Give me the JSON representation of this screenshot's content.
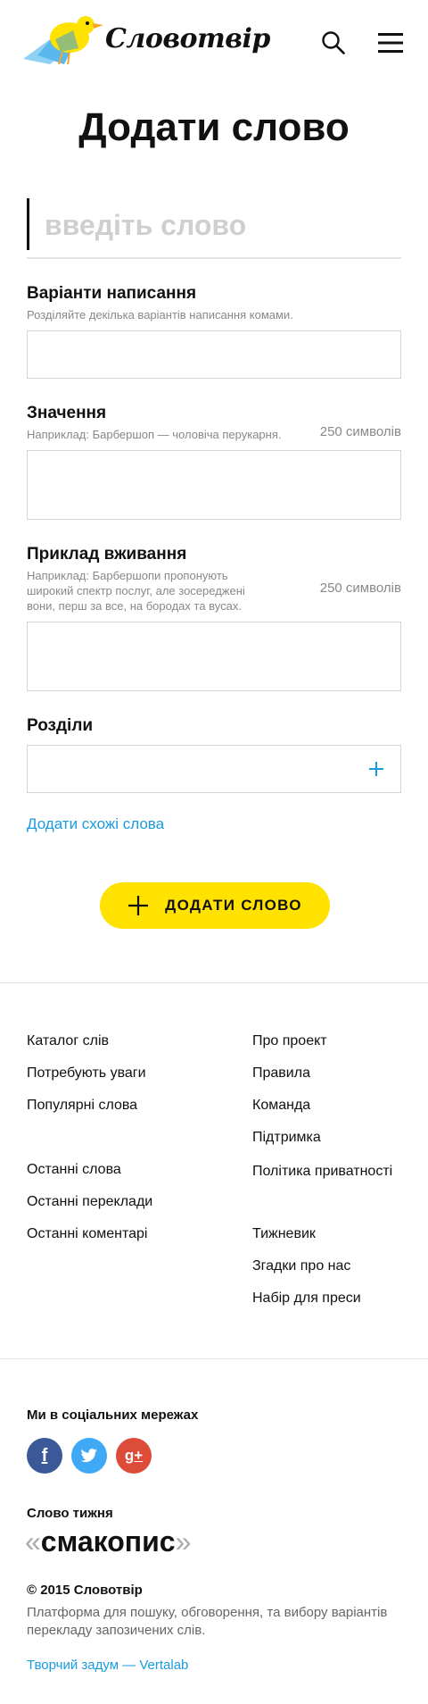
{
  "header": {
    "logo_text": "Словотвір",
    "icons": {
      "search": "search-icon",
      "menu": "menu-icon"
    }
  },
  "page_title": "Додати слово",
  "word_input": {
    "placeholder": "введіть слово",
    "value": ""
  },
  "spelling": {
    "title": "Варіанти написання",
    "hint": "Розділяйте декілька варіантів написання комами.",
    "value": ""
  },
  "meaning": {
    "title": "Значення",
    "hint": "Наприклад: Барбершоп — чоловіча перукарня.",
    "counter": "250 символів",
    "value": ""
  },
  "example": {
    "title": "Приклад вживання",
    "hint": "Наприклад: Барбершопи пропонують широкий спектр послуг, але зосереджені вони, перш за все, на бородах та вусах.",
    "counter": "250 символів",
    "value": ""
  },
  "sections": {
    "title": "Розділи",
    "value": ""
  },
  "similar_link": "Додати схожі слова",
  "add_button": "ДОДАТИ СЛОВО",
  "footer": {
    "left_links": [
      "Каталог слів",
      "Потребують уваги",
      "Популярні слова",
      "Останні слова",
      "Останні переклади",
      "Останні коментарі"
    ],
    "right_links": [
      "Про проект",
      "Правила",
      "Команда",
      "Підтримка",
      "Політика приватності",
      "Тижневик",
      "Згадки про нас",
      "Набір для преси"
    ],
    "social_title": "Ми в соціальних мережах",
    "social": [
      {
        "name": "facebook",
        "glyph": "f",
        "color": "#3b5998"
      },
      {
        "name": "twitter",
        "glyph": "t",
        "color": "#3fa9f5"
      },
      {
        "name": "google-plus",
        "glyph": "g+",
        "color": "#dd4b39"
      }
    ],
    "word_of_week_title": "Слово тижня",
    "word_of_week": {
      "open_quote": "«",
      "word": "смакопис",
      "close_quote": "»"
    },
    "copyright": "© 2015 Словотвір",
    "about": "Платформа для пошуку, обговорення, та вибору варіантів перекладу запозичених слів.",
    "credit": "Творчий задум — Vertalab"
  },
  "colors": {
    "accent_yellow": "#ffe200",
    "link_blue": "#1a9be0",
    "muted": "#888888"
  }
}
